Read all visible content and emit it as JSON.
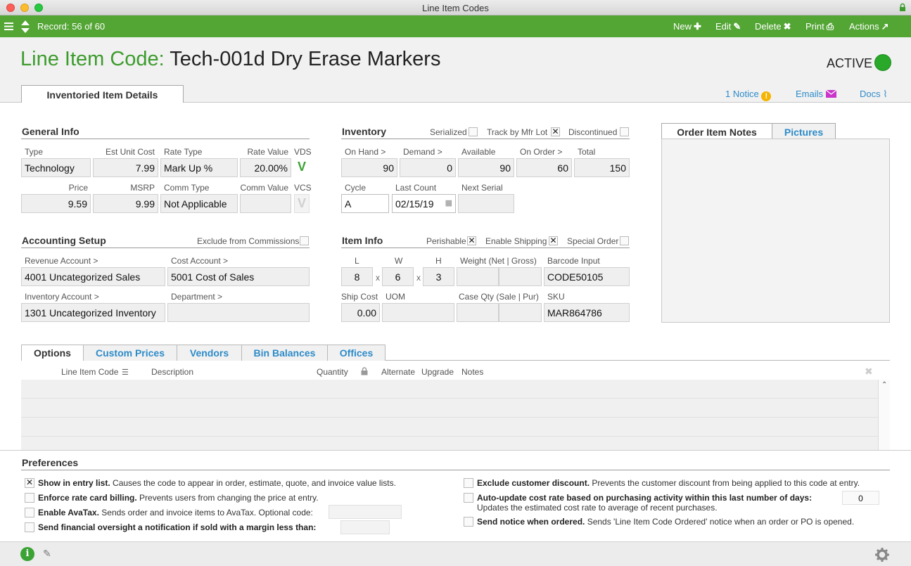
{
  "window": {
    "title": "Line Item Codes"
  },
  "toolbar": {
    "record": "Record: 56 of 60",
    "new": "New",
    "edit": "Edit",
    "delete": "Delete",
    "print": "Print",
    "actions": "Actions"
  },
  "header": {
    "label": "Line Item Code:",
    "code": "Tech-001d Dry Erase Markers",
    "status": "ACTIVE",
    "status_color": "#29a829",
    "tab": "Inventoried Item Details",
    "notice": "1 Notice",
    "emails": "Emails",
    "docs": "Docs"
  },
  "general": {
    "title": "General Info",
    "type_label": "Type",
    "type": "Technology",
    "est_unit_cost_label": "Est Unit Cost",
    "est_unit_cost": "7.99",
    "rate_type_label": "Rate Type",
    "rate_type": "Mark Up %",
    "rate_value_label": "Rate Value",
    "rate_value": "20.00%",
    "vds_label": "VDS",
    "vds": "V",
    "price_label": "Price",
    "price": "9.59",
    "msrp_label": "MSRP",
    "msrp": "9.99",
    "comm_type_label": "Comm Type",
    "comm_type": "Not Applicable",
    "comm_value_label": "Comm Value",
    "comm_value": "",
    "vcs_label": "VCS",
    "vcs": "V"
  },
  "accounting": {
    "title": "Accounting Setup",
    "exclude_label": "Exclude from Commissions",
    "revenue_label": "Revenue Account >",
    "revenue": "4001 Uncategorized Sales",
    "cost_label": "Cost Account >",
    "cost": "5001 Cost of Sales",
    "inventory_label": "Inventory Account >",
    "inventory": "1301 Uncategorized Inventory",
    "department_label": "Department >",
    "department": ""
  },
  "inventory": {
    "title": "Inventory",
    "serialized_label": "Serialized",
    "track_label": "Track by Mfr Lot",
    "discontinued_label": "Discontinued",
    "on_hand_label": "On Hand >",
    "on_hand": "90",
    "demand_label": "Demand >",
    "demand": "0",
    "available_label": "Available",
    "available": "90",
    "on_order_label": "On Order >",
    "on_order": "60",
    "total_label": "Total",
    "total": "150",
    "cycle_label": "Cycle",
    "cycle": "A",
    "last_count_label": "Last Count",
    "last_count": "02/15/19",
    "next_serial_label": "Next Serial",
    "next_serial": ""
  },
  "item_info": {
    "title": "Item Info",
    "perishable_label": "Perishable",
    "enable_shipping_label": "Enable Shipping",
    "special_order_label": "Special Order",
    "l_label": "L",
    "l": "8",
    "w_label": "W",
    "w": "6",
    "h_label": "H",
    "h": "3",
    "x": "x",
    "weight_label": "Weight (Net | Gross)",
    "barcode_label": "Barcode Input",
    "barcode": "CODE50105",
    "ship_cost_label": "Ship Cost",
    "ship_cost": "0.00",
    "uom_label": "UOM",
    "case_qty_label": "Case Qty (Sale | Pur)",
    "sku_label": "SKU",
    "sku": "MAR864786"
  },
  "notes": {
    "tab_notes": "Order Item Notes",
    "tab_pictures": "Pictures"
  },
  "lower_tabs": [
    "Options",
    "Custom Prices",
    "Vendors",
    "Bin Balances",
    "Offices"
  ],
  "options_columns": {
    "line_item_code": "Line Item Code",
    "description": "Description",
    "quantity": "Quantity",
    "alternate": "Alternate",
    "upgrade": "Upgrade",
    "notes": "Notes"
  },
  "preferences": {
    "title": "Preferences",
    "show_bold": "Show in entry list.",
    "show_desc": " Causes the code to appear in order, estimate, quote, and invoice value lists.",
    "enforce_bold": "Enforce rate card billing.",
    "enforce_desc": " Prevents users from changing the price at entry.",
    "avatax_bold": "Enable AvaTax.",
    "avatax_desc": " Sends order and invoice items to AvaTax. Optional code:",
    "oversight_bold": "Send financial oversight a notification if sold with a margin less than:",
    "exclude_bold": "Exclude customer discount.",
    "exclude_desc": " Prevents the customer discount from being applied to this code at entry.",
    "autoupdate_bold": "Auto-update cost rate based on purchasing activity within this last number of days:",
    "autoupdate_desc": "Updates the estimated cost rate to average of recent purchases.",
    "autoupdate_days": "0",
    "notice_bold": "Send notice when ordered.",
    "notice_desc": " Sends 'Line Item Code Ordered' notice when an order or PO is opened."
  },
  "colors": {
    "toolbar_green": "#53a534",
    "label_green": "#3c9b2c",
    "link_blue": "#2d8bc9"
  }
}
